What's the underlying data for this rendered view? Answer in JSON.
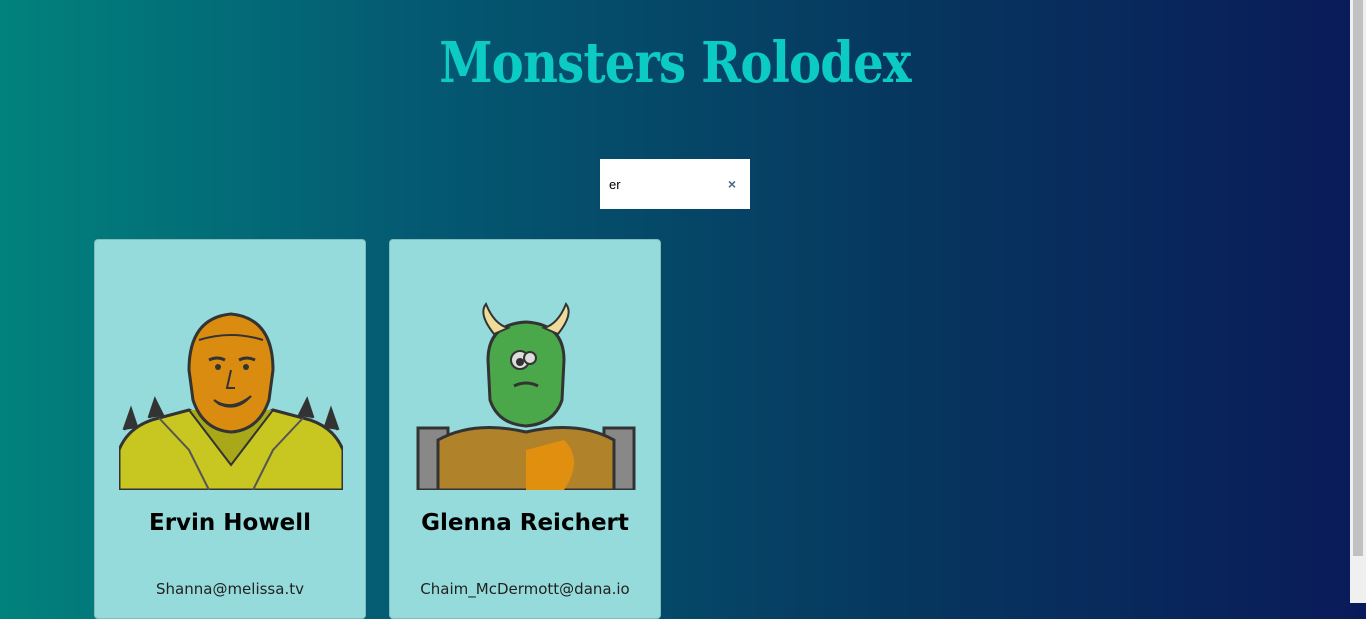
{
  "app": {
    "title": "Monsters Rolodex"
  },
  "search": {
    "value": "er",
    "clear_glyph": "×",
    "clear_icon": "close-icon"
  },
  "monsters": [
    {
      "name": "Ervin Howell",
      "email": "Shanna@melissa.tv",
      "icon": "monster-portrait-icon"
    },
    {
      "name": "Glenna Reichert",
      "email": "Chaim_McDermott@dana.io",
      "icon": "horned-monster-portrait-icon"
    }
  ],
  "colors": {
    "card_bg": "#95dbdb",
    "title": "#0ccac4",
    "bg_start": "#01827d",
    "bg_end": "#0a1a59"
  }
}
